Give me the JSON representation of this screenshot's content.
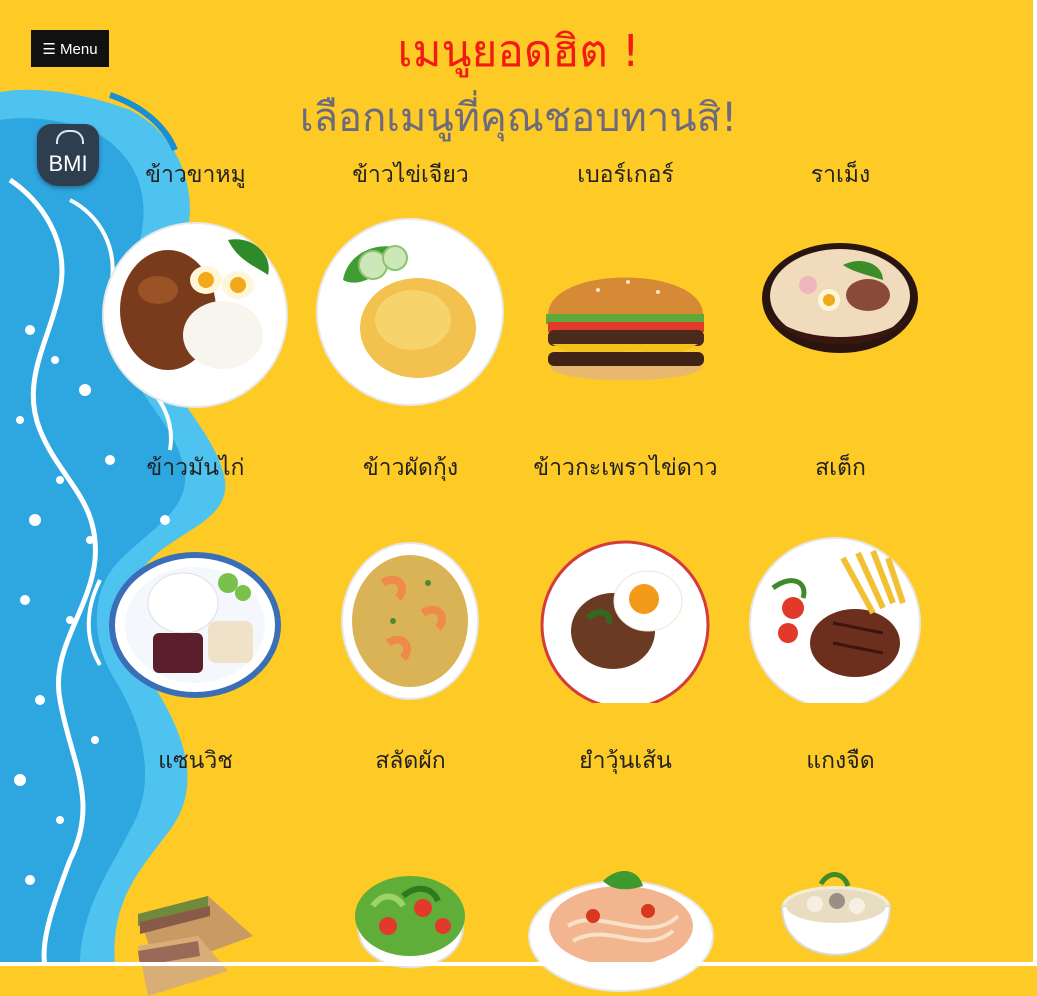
{
  "nav": {
    "menu_label": "☰ Menu"
  },
  "header": {
    "title": "เมนูยอดฮิต !",
    "subtitle": "เลือกเมนูที่คุณชอบทานสิ!"
  },
  "badge": {
    "label": "BMI"
  },
  "menu_items": [
    {
      "name": "ข้าวขาหมู"
    },
    {
      "name": "ข้าวไข่เจียว"
    },
    {
      "name": "เบอร์เกอร์"
    },
    {
      "name": "ราเม็ง"
    },
    {
      "name": "ข้าวมันไก่"
    },
    {
      "name": "ข้าวผัดกุ้ง"
    },
    {
      "name": "ข้าวกะเพราไข่ดาว"
    },
    {
      "name": "สเต็ก"
    },
    {
      "name": "แซนวิช"
    },
    {
      "name": "สลัดผัก"
    },
    {
      "name": "ยำวุ้นเส้น"
    },
    {
      "name": "แกงจืด"
    }
  ],
  "colors": {
    "background": "#FECB26",
    "title": "#F21B14",
    "subtitle": "#6E6A7E",
    "wave_blue": "#4FC3F0"
  }
}
